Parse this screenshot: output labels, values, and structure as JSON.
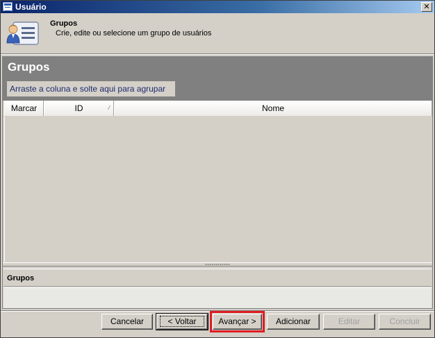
{
  "window": {
    "title": "Usuário",
    "close_label": "✕"
  },
  "header": {
    "title": "Grupos",
    "subtitle": "Crie, edite ou selecione um grupo de usuários",
    "icon": "user-list-icon"
  },
  "panel": {
    "title": "Grupos",
    "group_hint": "Arraste a coluna e solte aqui para agrupar",
    "columns": [
      "Marcar",
      "ID",
      "Nome"
    ],
    "sort_indicator": "⁄"
  },
  "detail": {
    "title": "Grupos"
  },
  "buttons": {
    "cancel": "Cancelar",
    "back": "< Voltar",
    "next": "Avançar >",
    "add": "Adicionar",
    "edit": "Editar",
    "finish": "Concluir"
  },
  "colors": {
    "title_bar": "#0a246a",
    "panel_caption": "#808080",
    "highlight": "#e01c24"
  }
}
